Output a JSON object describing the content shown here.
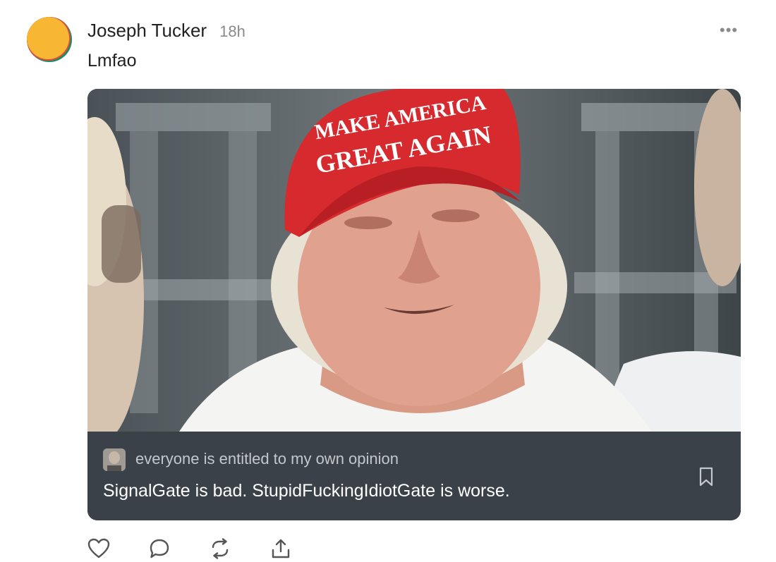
{
  "post": {
    "author": "Joseph Tucker",
    "time": "18h",
    "more_label": "•••",
    "text": "Lmfao"
  },
  "image": {
    "hat_line1": "MAKE AMERICA",
    "hat_line2": "GREAT AGAIN"
  },
  "caption": {
    "source": "everyone is entitled to my own opinion",
    "title": "SignalGate is bad. StupidFuckingIdiotGate is worse."
  },
  "actions": {
    "icons": [
      "heart-icon",
      "comment-icon",
      "restack-icon",
      "share-icon"
    ]
  },
  "colors": {
    "avatar_yellow": "#f7b733",
    "avatar_red": "#d94f3b",
    "avatar_green": "#1f8a61",
    "caption_bg": "#3a4148",
    "hat_red": "#d62a2f"
  }
}
